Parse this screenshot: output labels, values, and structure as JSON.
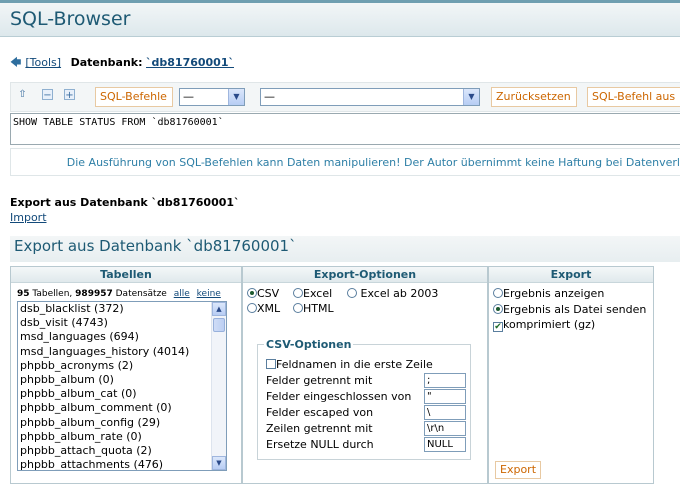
{
  "app": {
    "title": "SQL-Browser"
  },
  "breadcrumb": {
    "tools_link": "[Tools]",
    "db_label": "Datenbank:",
    "db_name": "`db81760001`"
  },
  "toolbar": {
    "sql_commands_label": "SQL-Befehle",
    "select_small_value": "—",
    "select_large_value": "—",
    "reset_label": "Zurücksetzen",
    "run_sql_label": "SQL-Befehl aus"
  },
  "sql_query": "SHOW TABLE STATUS FROM `db81760001`",
  "warning": "Die Ausführung von SQL-Befehlen kann Daten manipulieren! Der Autor übernimmt keine Haftung bei Datenverl",
  "export_heading": "Export aus Datenbank `db81760001`",
  "import_link": "Import",
  "section_title": "Export aus Datenbank `db81760001`",
  "tables_panel": {
    "header": "Tabellen",
    "stats_count": "95",
    "stats_tables_word": "Tabellen,",
    "stats_records": "989957",
    "stats_records_word": "Datensätze",
    "all_link": "alle",
    "none_link": "keine",
    "items": [
      "dsb_blacklist (372)",
      "dsb_visit (4743)",
      "msd_languages (694)",
      "msd_languages_history (4014)",
      "phpbb_acronyms (2)",
      "phpbb_album (0)",
      "phpbb_album_cat (0)",
      "phpbb_album_comment (0)",
      "phpbb_album_config (29)",
      "phpbb_album_rate (0)",
      "phpbb_attach_quota (2)",
      "phpbb_attachments (476)"
    ]
  },
  "options_panel": {
    "header": "Export-Optionen",
    "formats": {
      "csv": "CSV",
      "excel": "Excel",
      "excel2003": "Excel ab 2003",
      "xml": "XML",
      "html": "HTML"
    },
    "csv_legend": "CSV-Optionen",
    "field_names_label": "Feldnamen in die erste Zeile",
    "fields": [
      {
        "label": "Felder getrennt mit",
        "value": ";"
      },
      {
        "label": "Felder eingeschlossen von",
        "value": "\""
      },
      {
        "label": "Felder escaped von",
        "value": "\\"
      },
      {
        "label": "Zeilen getrennt mit",
        "value": "\\r\\n"
      },
      {
        "label": "Ersetze NULL durch",
        "value": "NULL"
      }
    ]
  },
  "export_panel": {
    "header": "Export",
    "show_result": "Ergebnis anzeigen",
    "send_as_file": "Ergebnis als Datei senden",
    "compressed": "komprimiert (gz)",
    "export_button": "Export"
  }
}
